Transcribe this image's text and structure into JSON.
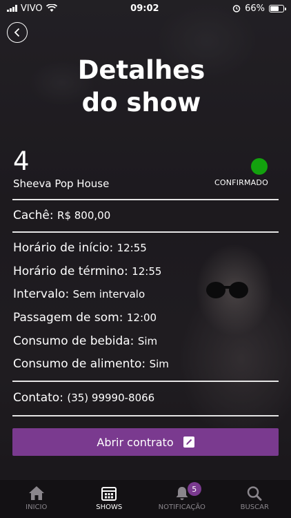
{
  "status_bar": {
    "carrier": "VIVO",
    "time": "09:02",
    "battery": "66%",
    "battery_level": 0.66
  },
  "header": {
    "title_line1": "Detalhes",
    "title_line2": "do show"
  },
  "show": {
    "number": "4",
    "venue": "Sheeva Pop House",
    "status": "CONFIRMADO",
    "status_color": "#13a10e"
  },
  "details": {
    "fee_label": "Cachê:",
    "fee_value": "R$ 800,00",
    "start_label": "Horário de início:",
    "start_value": "12:55",
    "end_label": "Horário de término:",
    "end_value": "12:55",
    "break_label": "Intervalo:",
    "break_value": "Sem intervalo",
    "soundcheck_label": "Passagem de som:",
    "soundcheck_value": "12:00",
    "drinks_label": "Consumo de bebida:",
    "drinks_value": "Sim",
    "food_label": "Consumo de alimento:",
    "food_value": "Sim",
    "contact_label": "Contato:",
    "contact_value": "(35) 99990-8066"
  },
  "actions": {
    "open_contract": "Abrir contrato",
    "accent_color": "#7a3a8f"
  },
  "tabs": [
    {
      "label": "INICIO",
      "icon": "home-icon",
      "active": false
    },
    {
      "label": "SHOWS",
      "icon": "calendar-icon",
      "active": true
    },
    {
      "label": "NOTIFICAÇÃO",
      "icon": "bell-icon",
      "active": false,
      "badge": "5"
    },
    {
      "label": "BUSCAR",
      "icon": "search-icon",
      "active": false
    }
  ]
}
